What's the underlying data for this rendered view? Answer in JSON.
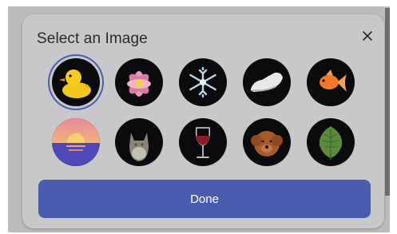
{
  "dialog": {
    "title": "Select an Image",
    "done_label": "Done",
    "selected_index": 0
  },
  "images": [
    {
      "icon": "rubber-duck-icon",
      "selected": true
    },
    {
      "icon": "lotus-flower-icon",
      "selected": false
    },
    {
      "icon": "snowflake-icon",
      "selected": false
    },
    {
      "icon": "sneaker-icon",
      "selected": false
    },
    {
      "icon": "goldfish-icon",
      "selected": false
    },
    {
      "icon": "sunset-icon",
      "selected": false
    },
    {
      "icon": "cat-icon",
      "selected": false
    },
    {
      "icon": "wine-glass-icon",
      "selected": false
    },
    {
      "icon": "dog-icon",
      "selected": false
    },
    {
      "icon": "leaf-icon",
      "selected": false
    }
  ],
  "colors": {
    "accent": "#4a5cae",
    "dialog_bg": "#c8c8cb",
    "backdrop": "#bcbcbf"
  }
}
